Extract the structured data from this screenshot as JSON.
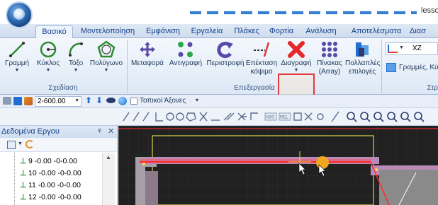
{
  "title": "lesso",
  "tabs": [
    "Βασικό",
    "Μοντελοποίηση",
    "Εμφάνιση",
    "Εργαλεία",
    "Πλάκες",
    "Φορτία",
    "Ανάλυση",
    "Αποτελέσματα",
    "Διασ"
  ],
  "ribbon": {
    "groups": {
      "drawing": "Σχεδίαση",
      "editing": "Επεξεργασία",
      "right": "Στρ"
    },
    "buttons": {
      "line": "Γραμμή",
      "circle": "Κύκλος",
      "arc": "Τόξο",
      "polygon": "Πολύγωνο",
      "move": "Μεταφορά",
      "copy": "Αντιγραφή",
      "rotate": "Περιστροφή",
      "extend": "Επέκταση",
      "trim": "κόψιμο",
      "delete": "Διαγραφή",
      "array": "Πίνακας",
      "array_sub": "(Array)",
      "multi": "Πολλαπλές",
      "multi_sub": "επιλογές",
      "view_label": "XZ",
      "lines": "Γραμμές, Κύ"
    }
  },
  "qat": {
    "level_value": "2-600.00",
    "local_axes": "Τοπικοί Άξονες"
  },
  "panel": {
    "title": "Δεδομένα Εργου",
    "close": "✕",
    "pin": "ᵠ",
    "rows": [
      "9 -0.00 -0-0.00",
      "10 -0.00 -0-0.00",
      "11 -0.00 -0-0.00",
      "12 -0.00 -0-0.00"
    ]
  },
  "colors": {
    "canvas": "#212121",
    "delete_highlight": "#e23a3a",
    "beam": "#ff2a2a",
    "accent": "#1e6fd0"
  }
}
